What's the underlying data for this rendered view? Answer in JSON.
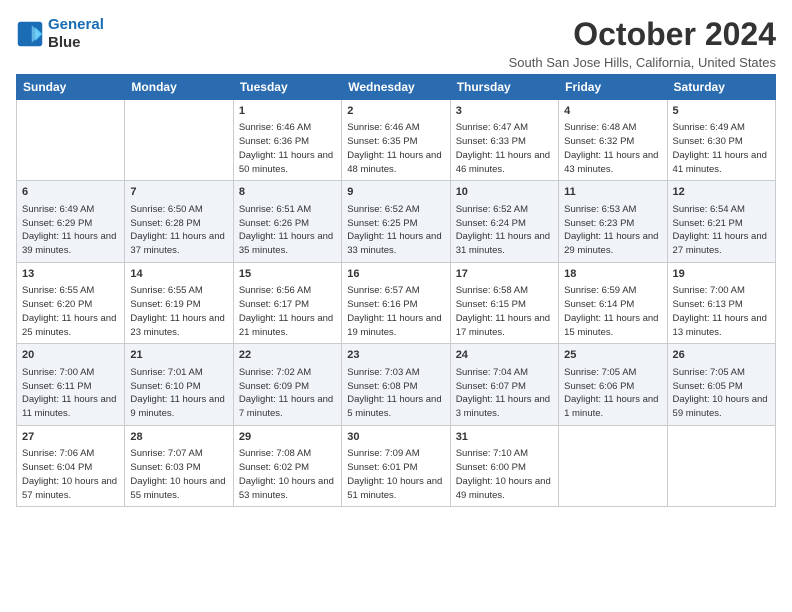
{
  "logo": {
    "line1": "General",
    "line2": "Blue"
  },
  "title": "October 2024",
  "location": "South San Jose Hills, California, United States",
  "days_of_week": [
    "Sunday",
    "Monday",
    "Tuesday",
    "Wednesday",
    "Thursday",
    "Friday",
    "Saturday"
  ],
  "weeks": [
    [
      {
        "day": "",
        "sunrise": "",
        "sunset": "",
        "daylight": ""
      },
      {
        "day": "",
        "sunrise": "",
        "sunset": "",
        "daylight": ""
      },
      {
        "day": "1",
        "sunrise": "Sunrise: 6:46 AM",
        "sunset": "Sunset: 6:36 PM",
        "daylight": "Daylight: 11 hours and 50 minutes."
      },
      {
        "day": "2",
        "sunrise": "Sunrise: 6:46 AM",
        "sunset": "Sunset: 6:35 PM",
        "daylight": "Daylight: 11 hours and 48 minutes."
      },
      {
        "day": "3",
        "sunrise": "Sunrise: 6:47 AM",
        "sunset": "Sunset: 6:33 PM",
        "daylight": "Daylight: 11 hours and 46 minutes."
      },
      {
        "day": "4",
        "sunrise": "Sunrise: 6:48 AM",
        "sunset": "Sunset: 6:32 PM",
        "daylight": "Daylight: 11 hours and 43 minutes."
      },
      {
        "day": "5",
        "sunrise": "Sunrise: 6:49 AM",
        "sunset": "Sunset: 6:30 PM",
        "daylight": "Daylight: 11 hours and 41 minutes."
      }
    ],
    [
      {
        "day": "6",
        "sunrise": "Sunrise: 6:49 AM",
        "sunset": "Sunset: 6:29 PM",
        "daylight": "Daylight: 11 hours and 39 minutes."
      },
      {
        "day": "7",
        "sunrise": "Sunrise: 6:50 AM",
        "sunset": "Sunset: 6:28 PM",
        "daylight": "Daylight: 11 hours and 37 minutes."
      },
      {
        "day": "8",
        "sunrise": "Sunrise: 6:51 AM",
        "sunset": "Sunset: 6:26 PM",
        "daylight": "Daylight: 11 hours and 35 minutes."
      },
      {
        "day": "9",
        "sunrise": "Sunrise: 6:52 AM",
        "sunset": "Sunset: 6:25 PM",
        "daylight": "Daylight: 11 hours and 33 minutes."
      },
      {
        "day": "10",
        "sunrise": "Sunrise: 6:52 AM",
        "sunset": "Sunset: 6:24 PM",
        "daylight": "Daylight: 11 hours and 31 minutes."
      },
      {
        "day": "11",
        "sunrise": "Sunrise: 6:53 AM",
        "sunset": "Sunset: 6:23 PM",
        "daylight": "Daylight: 11 hours and 29 minutes."
      },
      {
        "day": "12",
        "sunrise": "Sunrise: 6:54 AM",
        "sunset": "Sunset: 6:21 PM",
        "daylight": "Daylight: 11 hours and 27 minutes."
      }
    ],
    [
      {
        "day": "13",
        "sunrise": "Sunrise: 6:55 AM",
        "sunset": "Sunset: 6:20 PM",
        "daylight": "Daylight: 11 hours and 25 minutes."
      },
      {
        "day": "14",
        "sunrise": "Sunrise: 6:55 AM",
        "sunset": "Sunset: 6:19 PM",
        "daylight": "Daylight: 11 hours and 23 minutes."
      },
      {
        "day": "15",
        "sunrise": "Sunrise: 6:56 AM",
        "sunset": "Sunset: 6:17 PM",
        "daylight": "Daylight: 11 hours and 21 minutes."
      },
      {
        "day": "16",
        "sunrise": "Sunrise: 6:57 AM",
        "sunset": "Sunset: 6:16 PM",
        "daylight": "Daylight: 11 hours and 19 minutes."
      },
      {
        "day": "17",
        "sunrise": "Sunrise: 6:58 AM",
        "sunset": "Sunset: 6:15 PM",
        "daylight": "Daylight: 11 hours and 17 minutes."
      },
      {
        "day": "18",
        "sunrise": "Sunrise: 6:59 AM",
        "sunset": "Sunset: 6:14 PM",
        "daylight": "Daylight: 11 hours and 15 minutes."
      },
      {
        "day": "19",
        "sunrise": "Sunrise: 7:00 AM",
        "sunset": "Sunset: 6:13 PM",
        "daylight": "Daylight: 11 hours and 13 minutes."
      }
    ],
    [
      {
        "day": "20",
        "sunrise": "Sunrise: 7:00 AM",
        "sunset": "Sunset: 6:11 PM",
        "daylight": "Daylight: 11 hours and 11 minutes."
      },
      {
        "day": "21",
        "sunrise": "Sunrise: 7:01 AM",
        "sunset": "Sunset: 6:10 PM",
        "daylight": "Daylight: 11 hours and 9 minutes."
      },
      {
        "day": "22",
        "sunrise": "Sunrise: 7:02 AM",
        "sunset": "Sunset: 6:09 PM",
        "daylight": "Daylight: 11 hours and 7 minutes."
      },
      {
        "day": "23",
        "sunrise": "Sunrise: 7:03 AM",
        "sunset": "Sunset: 6:08 PM",
        "daylight": "Daylight: 11 hours and 5 minutes."
      },
      {
        "day": "24",
        "sunrise": "Sunrise: 7:04 AM",
        "sunset": "Sunset: 6:07 PM",
        "daylight": "Daylight: 11 hours and 3 minutes."
      },
      {
        "day": "25",
        "sunrise": "Sunrise: 7:05 AM",
        "sunset": "Sunset: 6:06 PM",
        "daylight": "Daylight: 11 hours and 1 minute."
      },
      {
        "day": "26",
        "sunrise": "Sunrise: 7:05 AM",
        "sunset": "Sunset: 6:05 PM",
        "daylight": "Daylight: 10 hours and 59 minutes."
      }
    ],
    [
      {
        "day": "27",
        "sunrise": "Sunrise: 7:06 AM",
        "sunset": "Sunset: 6:04 PM",
        "daylight": "Daylight: 10 hours and 57 minutes."
      },
      {
        "day": "28",
        "sunrise": "Sunrise: 7:07 AM",
        "sunset": "Sunset: 6:03 PM",
        "daylight": "Daylight: 10 hours and 55 minutes."
      },
      {
        "day": "29",
        "sunrise": "Sunrise: 7:08 AM",
        "sunset": "Sunset: 6:02 PM",
        "daylight": "Daylight: 10 hours and 53 minutes."
      },
      {
        "day": "30",
        "sunrise": "Sunrise: 7:09 AM",
        "sunset": "Sunset: 6:01 PM",
        "daylight": "Daylight: 10 hours and 51 minutes."
      },
      {
        "day": "31",
        "sunrise": "Sunrise: 7:10 AM",
        "sunset": "Sunset: 6:00 PM",
        "daylight": "Daylight: 10 hours and 49 minutes."
      },
      {
        "day": "",
        "sunrise": "",
        "sunset": "",
        "daylight": ""
      },
      {
        "day": "",
        "sunrise": "",
        "sunset": "",
        "daylight": ""
      }
    ]
  ]
}
